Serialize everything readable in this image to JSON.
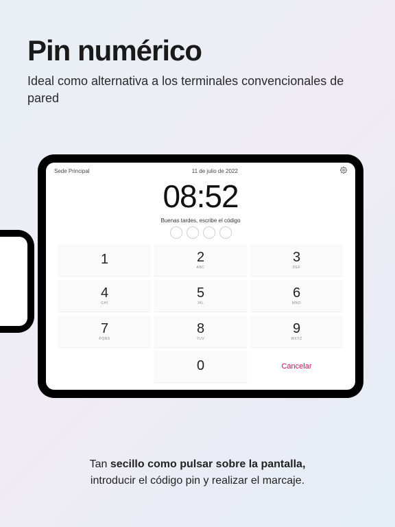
{
  "header": {
    "title": "Pin numérico",
    "subtitle": "Ideal como alternativa a los terminales convencionales de pared"
  },
  "tablet": {
    "location": "Sede Principal",
    "date": "11 de julio de 2022",
    "time": "08:52",
    "prompt": "Buenas tardes, escribe el código",
    "keys": {
      "k1": {
        "num": "1",
        "sub": ""
      },
      "k2": {
        "num": "2",
        "sub": "ABC"
      },
      "k3": {
        "num": "3",
        "sub": "DEF"
      },
      "k4": {
        "num": "4",
        "sub": "GHI"
      },
      "k5": {
        "num": "5",
        "sub": "JKL"
      },
      "k6": {
        "num": "6",
        "sub": "MNO"
      },
      "k7": {
        "num": "7",
        "sub": "PQRS"
      },
      "k8": {
        "num": "8",
        "sub": "TUV"
      },
      "k9": {
        "num": "9",
        "sub": "WXYZ"
      },
      "k0": {
        "num": "0",
        "sub": ""
      }
    },
    "cancel": "Cancelar"
  },
  "footer": {
    "line1_prefix": "Tan ",
    "line1_bold": "secillo como pulsar sobre la pantalla,",
    "line2": "introducir el código pin y realizar el marcaje."
  }
}
